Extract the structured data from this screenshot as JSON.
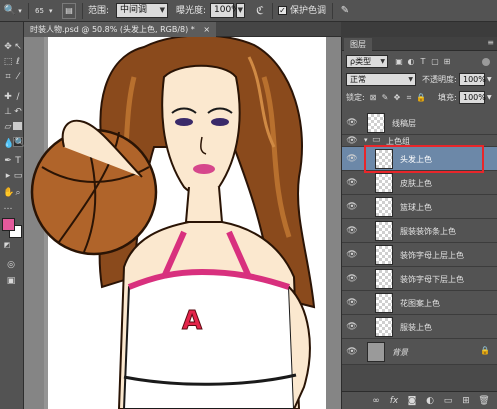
{
  "options_bar": {
    "tool_glyph": "🔍",
    "tool_dropdown_glyph": "▾",
    "brush_size": "65",
    "range_label": "范围:",
    "range_value": "中间调",
    "exposure_label": "曝光度:",
    "exposure_value": "100%",
    "airbrush_glyph": "ℭ",
    "protect_tones_label": "保护色调"
  },
  "document_tab": {
    "title": "时装人物.psd @ 50.8% (头发上色, RGB/8) *",
    "close_glyph": "×"
  },
  "layers_panel": {
    "tab_label": "图层",
    "kind_filter": "ρ类型",
    "blend_mode": "正常",
    "opacity_label": "不透明度:",
    "opacity_value": "100%",
    "lock_label": "锁定:",
    "fill_label": "填充:",
    "fill_value": "100%",
    "layers": [
      {
        "name": "线稿层",
        "group": false,
        "selected": false
      },
      {
        "name": "上色组",
        "group": true,
        "selected": false
      },
      {
        "name": "头发上色",
        "group": false,
        "selected": true
      },
      {
        "name": "皮肤上色",
        "group": false,
        "selected": false
      },
      {
        "name": "篮球上色",
        "group": false,
        "selected": false
      },
      {
        "name": "服装装饰条上色",
        "group": false,
        "selected": false
      },
      {
        "name": "装饰字母上层上色",
        "group": false,
        "selected": false
      },
      {
        "name": "装饰字母下层上色",
        "group": false,
        "selected": false
      },
      {
        "name": "花图案上色",
        "group": false,
        "selected": false
      },
      {
        "name": "服装上色",
        "group": false,
        "selected": false
      },
      {
        "name": "背景",
        "group": false,
        "selected": false
      }
    ]
  },
  "canvas": {
    "letter_mark": "A"
  },
  "colors": {
    "foreground": "#e45a9c",
    "background": "#ffffff",
    "annotation_red": "#e8262a",
    "selection_blue": "#6c88a8"
  }
}
